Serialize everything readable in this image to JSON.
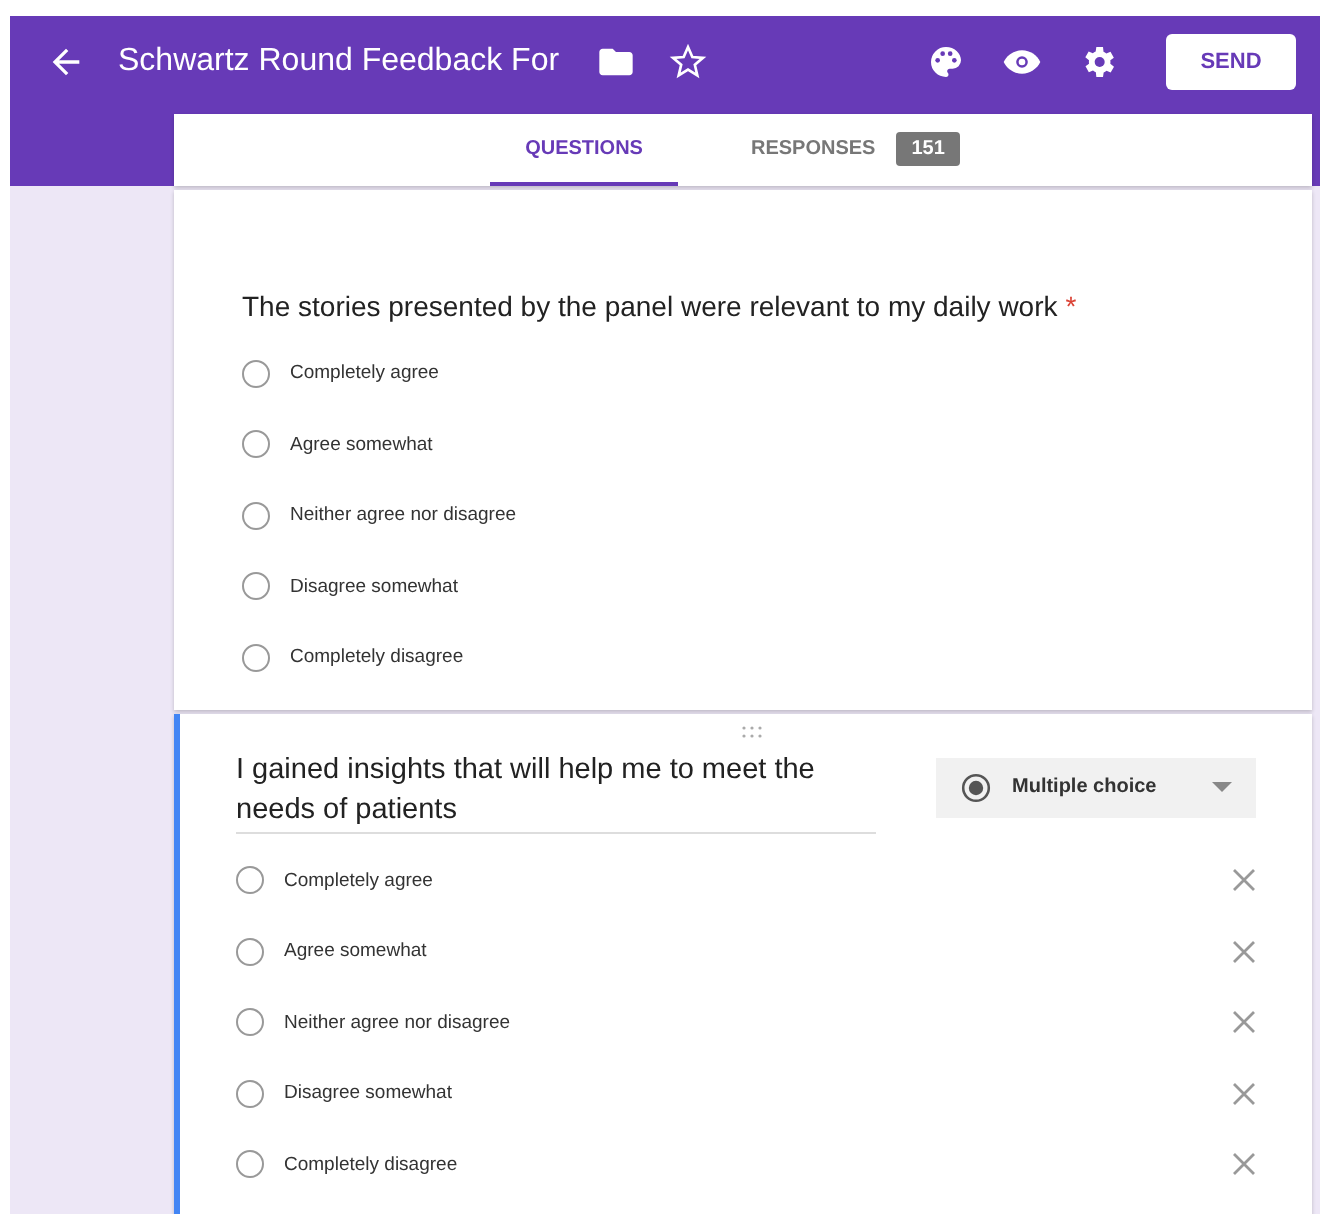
{
  "header": {
    "title": "Schwartz Round Feedback For",
    "send_label": "SEND"
  },
  "tabs": [
    {
      "label": "QUESTIONS",
      "selected": true
    },
    {
      "label": "RESPONSES",
      "selected": false,
      "count": "151"
    }
  ],
  "questions": [
    {
      "text": "The stories presented by the panel were relevant to my daily work",
      "required_mark": "*",
      "active": false,
      "options": [
        "Completely agree",
        "Agree somewhat",
        "Neither agree nor disagree",
        "Disagree somewhat",
        "Completely disagree"
      ]
    },
    {
      "text": "I gained insights that will help me to meet the needs of patients",
      "active": true,
      "type_label": "Multiple choice",
      "options": [
        "Completely agree",
        "Agree somewhat",
        "Neither agree nor disagree",
        "Disagree somewhat",
        "Completely disagree"
      ]
    }
  ]
}
